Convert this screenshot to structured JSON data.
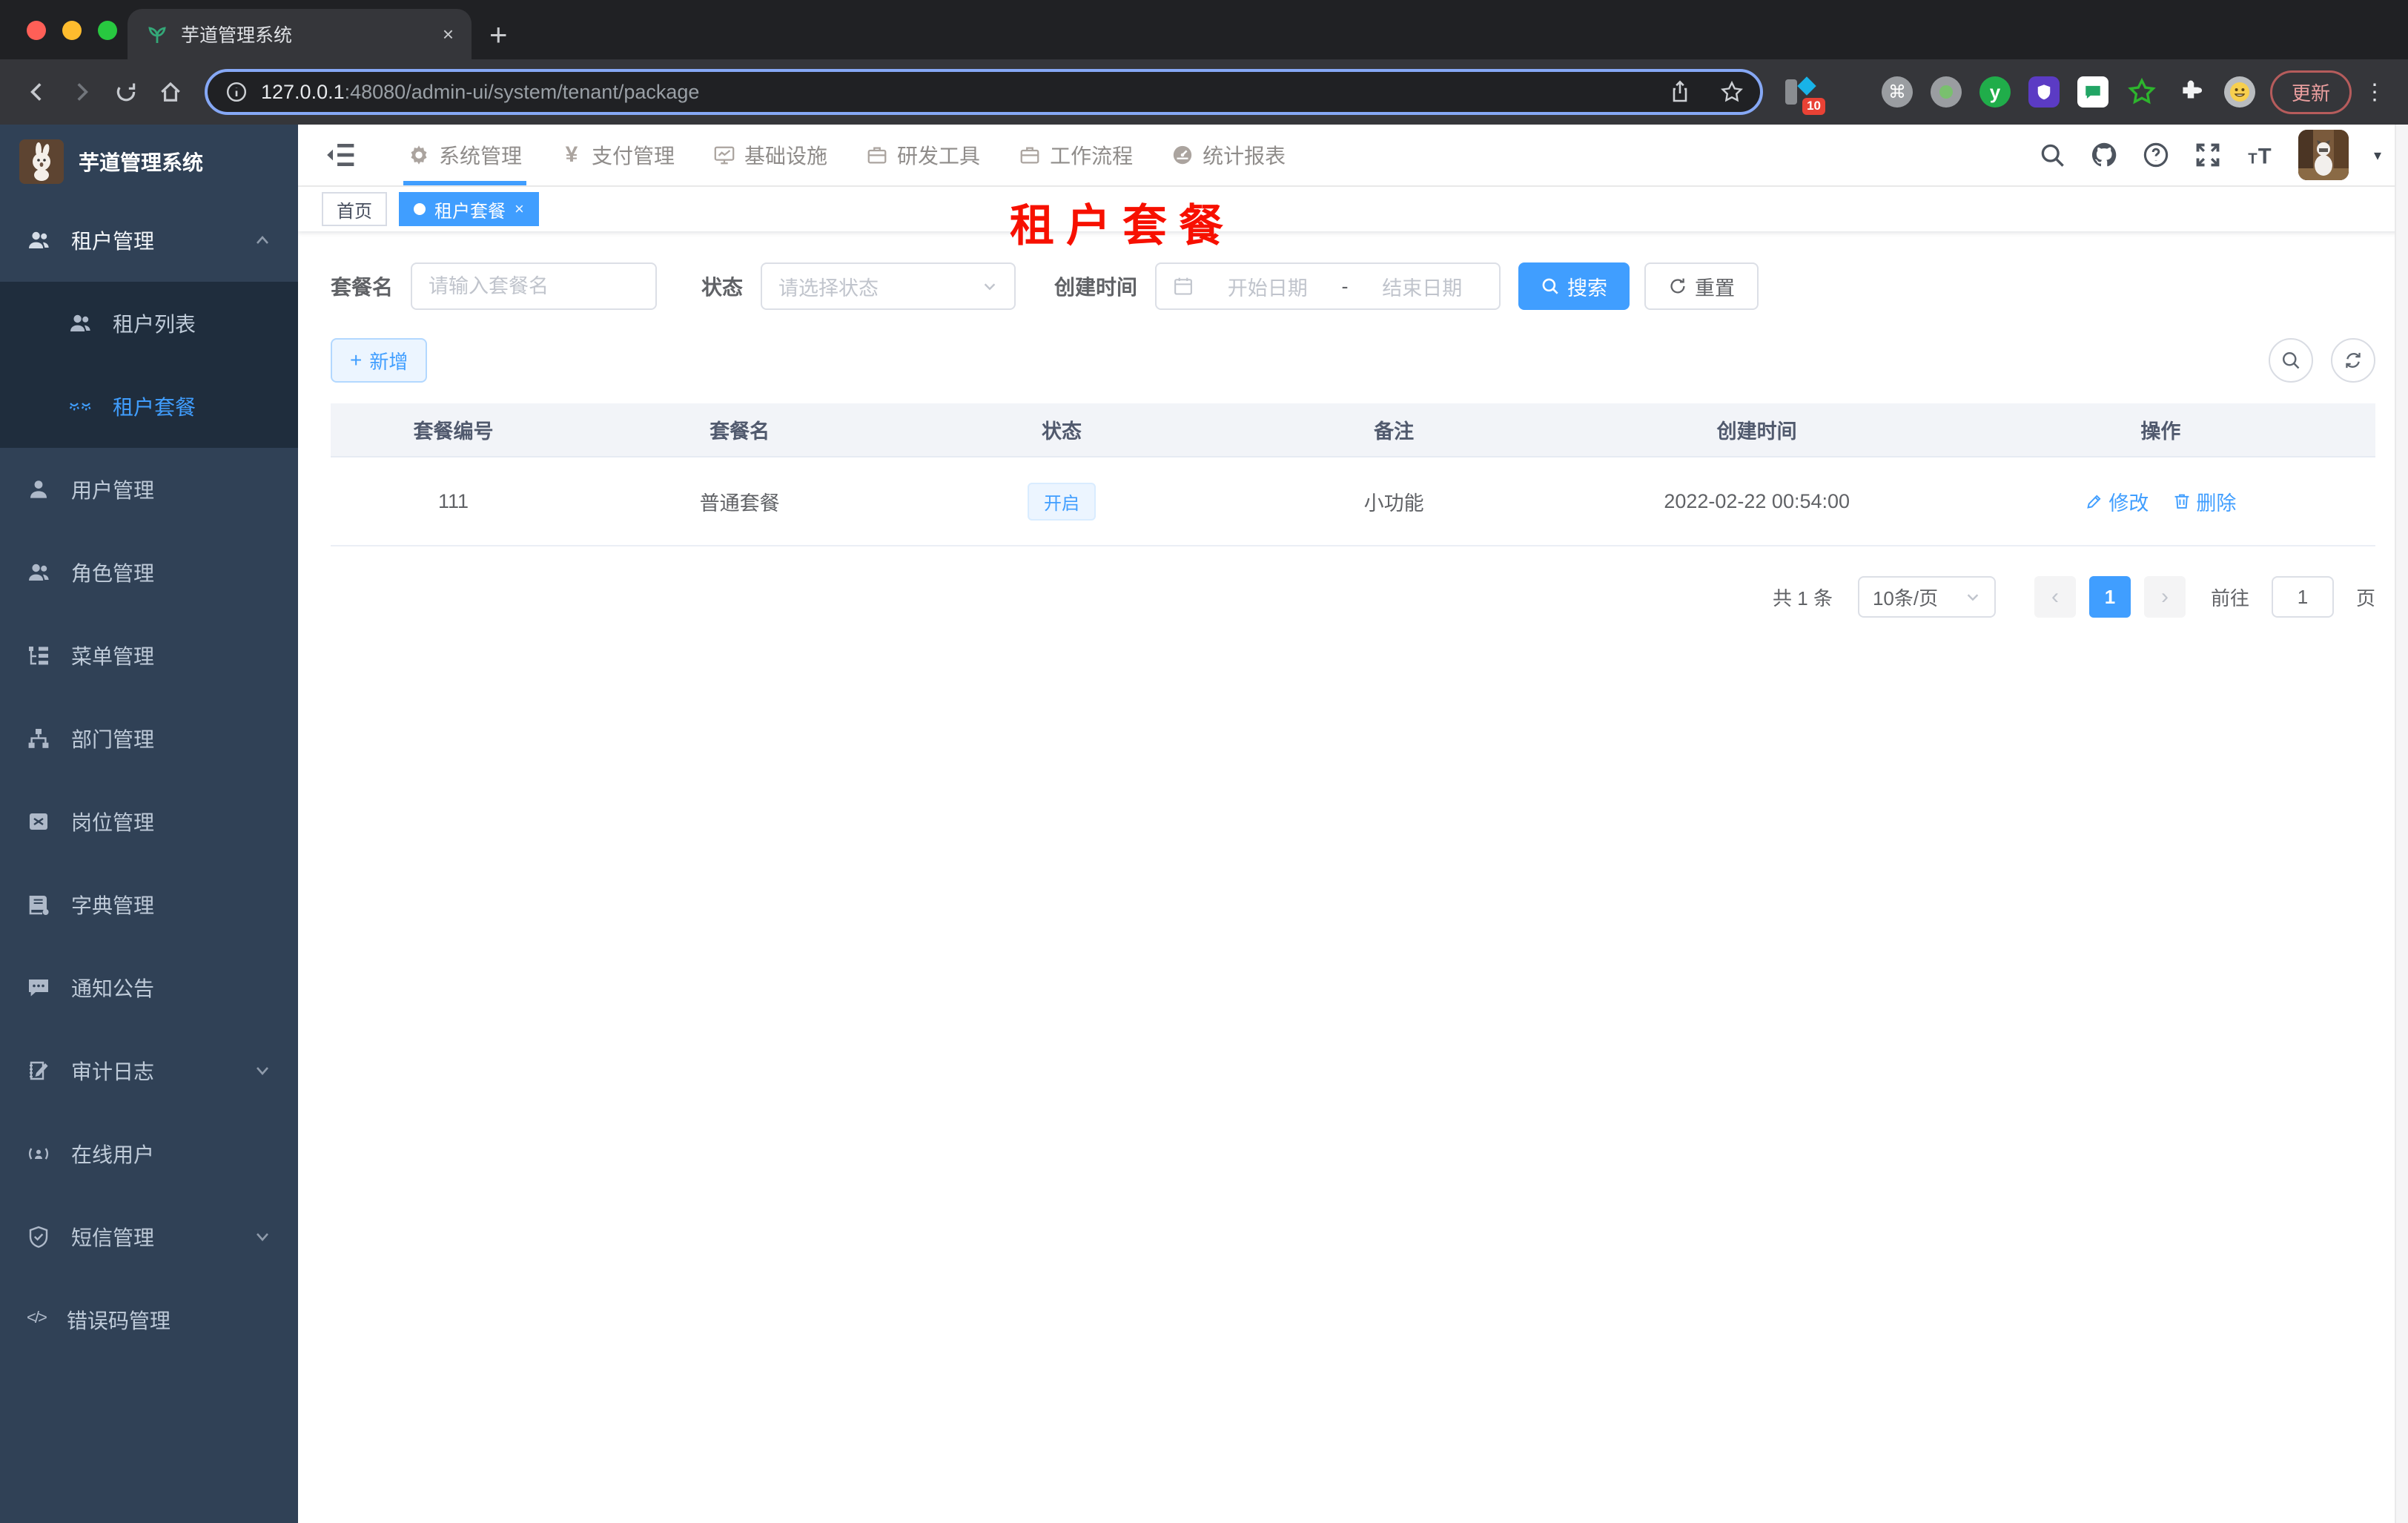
{
  "browser": {
    "tab_title": "芋道管理系统",
    "url_host": "127.0.0.1",
    "url_rest": ":48080/admin-ui/system/tenant/package",
    "update_label": "更新",
    "ext_badge": "10"
  },
  "icons": {
    "close": "×",
    "plus": "+",
    "kebab": "⋮",
    "caret": "▾",
    "prev": "‹",
    "next": "›",
    "code": "</>",
    "command": "⌘",
    "yen": "¥",
    "y_logo": "y"
  },
  "app": {
    "logo_title": "芋道管理系统",
    "top_nav": [
      {
        "label": "系统管理"
      },
      {
        "label": "支付管理"
      },
      {
        "label": "基础设施"
      },
      {
        "label": "研发工具"
      },
      {
        "label": "工作流程"
      },
      {
        "label": "统计报表"
      }
    ],
    "tags": {
      "home": "首页",
      "current": "租户套餐"
    },
    "overlay_title": "租户套餐",
    "sidebar": [
      {
        "label": "租户管理"
      },
      {
        "label": "租户列表"
      },
      {
        "label": "租户套餐"
      },
      {
        "label": "用户管理"
      },
      {
        "label": "角色管理"
      },
      {
        "label": "菜单管理"
      },
      {
        "label": "部门管理"
      },
      {
        "label": "岗位管理"
      },
      {
        "label": "字典管理"
      },
      {
        "label": "通知公告"
      },
      {
        "label": "审计日志"
      },
      {
        "label": "在线用户"
      },
      {
        "label": "短信管理"
      },
      {
        "label": "错误码管理"
      }
    ],
    "search": {
      "name_label": "套餐名",
      "name_placeholder": "请输入套餐名",
      "status_label": "状态",
      "status_placeholder": "请选择状态",
      "date_label": "创建时间",
      "date_start": "开始日期",
      "date_sep": "-",
      "date_end": "结束日期",
      "search_button": "搜索",
      "reset_button": "重置"
    },
    "toolbar": {
      "add_button": "新增"
    },
    "table": {
      "headers": [
        "套餐编号",
        "套餐名",
        "状态",
        "备注",
        "创建时间",
        "操作"
      ],
      "row": {
        "id": "111",
        "name": "普通套餐",
        "status": "开启",
        "remark": "小功能",
        "created": "2022-02-22 00:54:00",
        "edit": "修改",
        "delete": "删除"
      }
    },
    "pagination": {
      "total": "共 1 条",
      "size": "10条/页",
      "page": "1",
      "goto": "前往",
      "unit": "页",
      "goto_value": "1"
    },
    "colors": {
      "accent": "#409eff",
      "overlay_red": "#f71000",
      "sidebar_bg": "#304156"
    }
  }
}
